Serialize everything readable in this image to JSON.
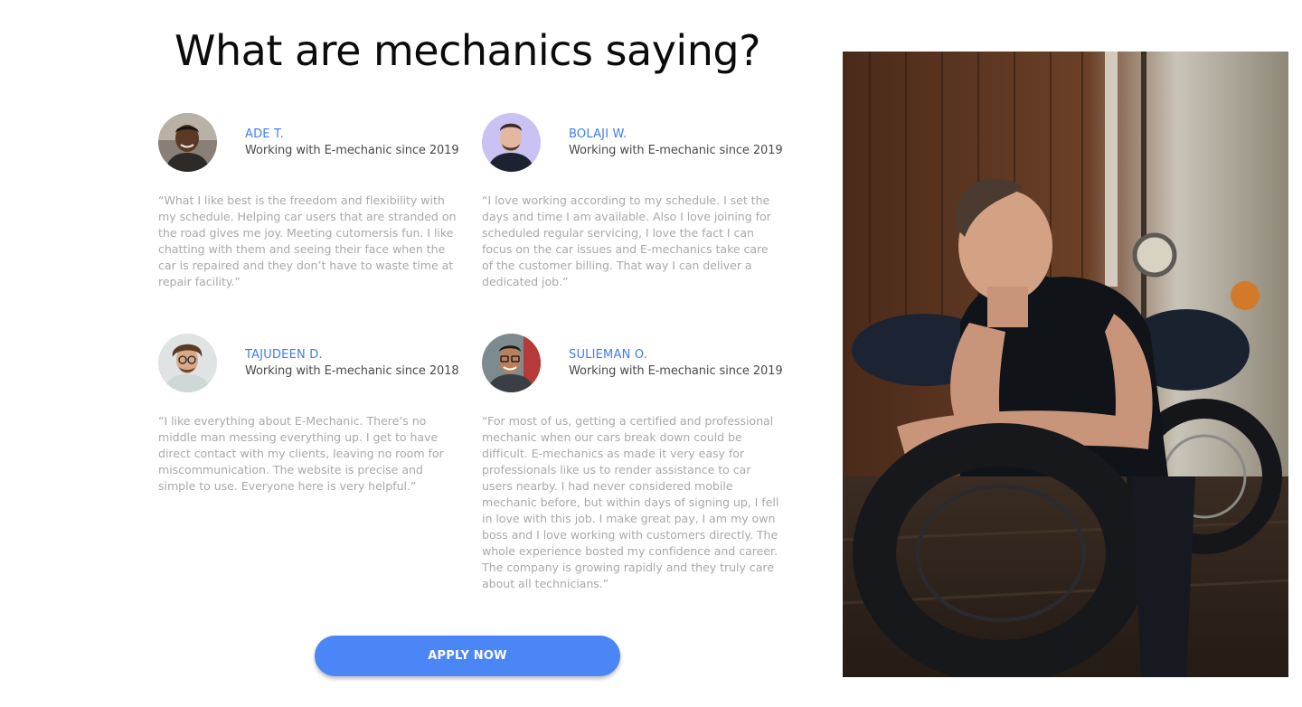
{
  "section": {
    "title": "What are mechanics saying?"
  },
  "testimonials": [
    {
      "name": "ADE T.",
      "since": "Working with E-mechanic since 2019",
      "quote": "“What I like best is the freedom and flexibility with my schedule. Helping car users that are stranded on the road gives me joy. Meeting cutomersis fun. I like chatting with them and seeing their face when the car is repaired and they don’t have to waste time at repair facility.”"
    },
    {
      "name": "BOLAJI W.",
      "since": "Working with E-mechanic since 2019",
      "quote": "“I love working according to my schedule. I set the days and time I am available. Also I love joining for scheduled regular servicing, I love the fact I can focus on the car issues and E-mechanics take care of the customer billing. That way I can deliver a dedicated job.”"
    },
    {
      "name": "TAJUDEEN D.",
      "since": "Working with E-mechanic since 2018",
      "quote": "“I like everything about E-Mechanic. There’s no middle man messing everything up. I get to have direct contact with my clients, leaving no room for miscommunication. The website is precise and simple to use. Everyone here is very helpful.”"
    },
    {
      "name": "SULIEMAN O.",
      "since": "Working with E-mechanic since 2019",
      "quote": "“For most of us, getting a certified and professional mechanic when our cars break down could be difficult. E-mechanics as made it very easy for professionals like us to render assistance to car users nearby. I had never considered mobile mechanic before, but within days of signing up, I fell in love with this job. I make great pay, I am my own boss and I love working with customers directly. The whole experience bosted my confidence and career. The company is growing rapidly and they truly care about all technicians.”"
    }
  ],
  "cta": {
    "label": "APPLY NOW"
  },
  "colors": {
    "accent": "#4a86f5",
    "name_text": "#3f7cf0",
    "quote_text": "#a9a9a9"
  },
  "images": {
    "hero": "mechanic-with-tire-photo",
    "avatars": [
      "avatar-photo",
      "avatar-photo",
      "avatar-photo",
      "avatar-photo"
    ]
  }
}
